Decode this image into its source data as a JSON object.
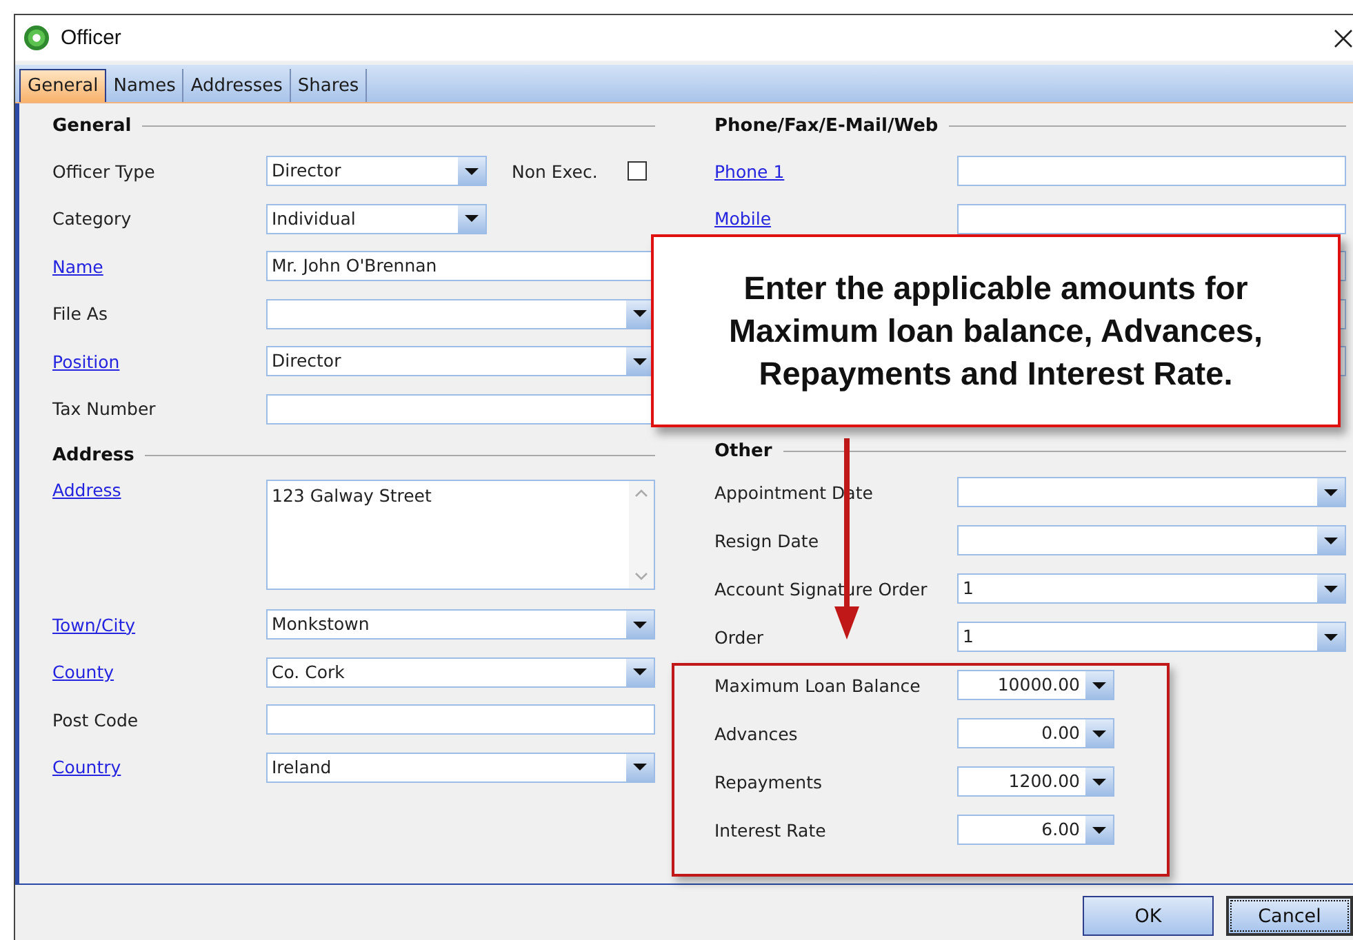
{
  "window": {
    "title": "Officer"
  },
  "tabs": [
    {
      "label": "General",
      "selected": true
    },
    {
      "label": "Names",
      "selected": false
    },
    {
      "label": "Addresses",
      "selected": false
    },
    {
      "label": "Shares",
      "selected": false
    }
  ],
  "general": {
    "heading": "General",
    "rows": [
      {
        "label": "Officer Type",
        "link": false,
        "kind": "short-dropdown",
        "value": "Director",
        "checkbox": {
          "label": "Non Exec.",
          "checked": false
        }
      },
      {
        "label": "Category",
        "link": false,
        "kind": "short-dropdown",
        "value": "Individual"
      },
      {
        "label": "Name",
        "link": true,
        "kind": "text",
        "value": "Mr. John O'Brennan"
      },
      {
        "label": "File As",
        "link": false,
        "kind": "dropdown"
      },
      {
        "label": "Position",
        "link": true,
        "kind": "dropdown",
        "value": "Director"
      },
      {
        "label": "Tax Number",
        "link": false,
        "kind": "text"
      }
    ]
  },
  "address": {
    "heading": "Address",
    "rows": [
      {
        "label": "Address",
        "link": true,
        "kind": "textarea",
        "value": "123 Galway Street"
      },
      {
        "label": "Town/City",
        "link": true,
        "kind": "dropdown",
        "value": "Monkstown"
      },
      {
        "label": "County",
        "link": true,
        "kind": "dropdown",
        "value": "Co. Cork"
      },
      {
        "label": "Post Code",
        "link": false,
        "kind": "text"
      },
      {
        "label": "Country",
        "link": true,
        "kind": "dropdown",
        "value": "Ireland"
      }
    ]
  },
  "contact": {
    "heading": "Phone/Fax/E-Mail/Web",
    "rows": [
      {
        "label": "Phone 1",
        "link": true,
        "kind": "text"
      },
      {
        "label": "Mobile",
        "link": true,
        "kind": "text"
      },
      {
        "kind": "text"
      },
      {
        "kind": "text"
      },
      {
        "kind": "text"
      }
    ]
  },
  "other": {
    "heading": "Other",
    "rows": [
      {
        "label": "Appointment Date",
        "link": false,
        "kind": "dropdown"
      },
      {
        "label": "Resign Date",
        "link": false,
        "kind": "dropdown"
      },
      {
        "label": "Account Signature Order",
        "link": false,
        "kind": "dropdown",
        "value": "1"
      },
      {
        "label": "Order",
        "link": false,
        "kind": "dropdown",
        "value": "1"
      },
      {
        "label": "Maximum Loan Balance",
        "link": false,
        "kind": "amount",
        "value": "10000.00"
      },
      {
        "label": "Advances",
        "link": false,
        "kind": "amount",
        "value": "0.00"
      },
      {
        "label": "Repayments",
        "link": false,
        "kind": "amount",
        "value": "1200.00"
      },
      {
        "label": "Interest Rate",
        "link": false,
        "kind": "amount",
        "value": "6.00"
      }
    ]
  },
  "callout": {
    "text": "Enter the applicable amounts for Maximum loan balance, Advances, Repayments and Interest Rate."
  },
  "buttons": [
    {
      "label": "OK",
      "focused": false
    },
    {
      "label": "Cancel",
      "focused": true
    }
  ]
}
